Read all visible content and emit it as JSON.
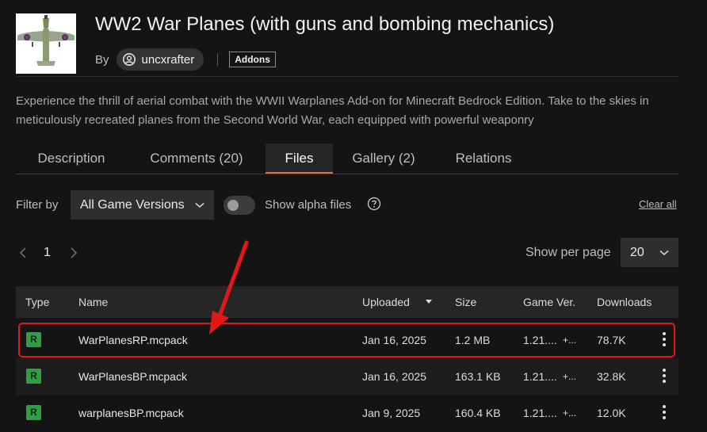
{
  "project": {
    "title": "WW2 War Planes (with guns and bombing mechanics)",
    "by_label": "By",
    "author": "uncxrafter",
    "tag": "Addons",
    "summary": "Experience the thrill of aerial combat with the WWII Warplanes Add-on for Minecraft Bedrock Edition. Take to the skies in meticulously recreated planes from the Second World War, each equipped with powerful weaponry"
  },
  "tabs": [
    {
      "label": "Description",
      "active": false
    },
    {
      "label": "Comments (20)",
      "active": false
    },
    {
      "label": "Files",
      "active": true
    },
    {
      "label": "Gallery (2)",
      "active": false
    },
    {
      "label": "Relations",
      "active": false
    }
  ],
  "filters": {
    "filter_label": "Filter by",
    "game_version": "All Game Versions",
    "alpha_label": "Show alpha files",
    "alpha_enabled": false,
    "clear_all": "Clear all"
  },
  "pagination": {
    "current_page": "1",
    "per_page_label": "Show per page",
    "per_page": "20"
  },
  "table": {
    "columns": [
      "Type",
      "Name",
      "Uploaded",
      "Size",
      "Game Ver.",
      "Downloads"
    ],
    "sorted_column": "Uploaded",
    "rows": [
      {
        "type": "R",
        "name": "WarPlanesRP.mcpack",
        "uploaded": "Jan 16, 2025",
        "size": "1.2 MB",
        "game_ver": "1.21....",
        "more_versions": "+...",
        "downloads": "78.7K",
        "highlighted": true
      },
      {
        "type": "R",
        "name": "WarPlanesBP.mcpack",
        "uploaded": "Jan 16, 2025",
        "size": "163.1 KB",
        "game_ver": "1.21....",
        "more_versions": "+...",
        "downloads": "32.8K",
        "highlighted": false
      },
      {
        "type": "R",
        "name": "warplanesBP.mcpack",
        "uploaded": "Jan 9, 2025",
        "size": "160.4 KB",
        "game_ver": "1.21....",
        "more_versions": "+...",
        "downloads": "12.0K",
        "highlighted": false
      }
    ]
  },
  "colors": {
    "accent": "#e96c43",
    "release_badge": "#2f9e44",
    "annotation": "#e01818"
  }
}
